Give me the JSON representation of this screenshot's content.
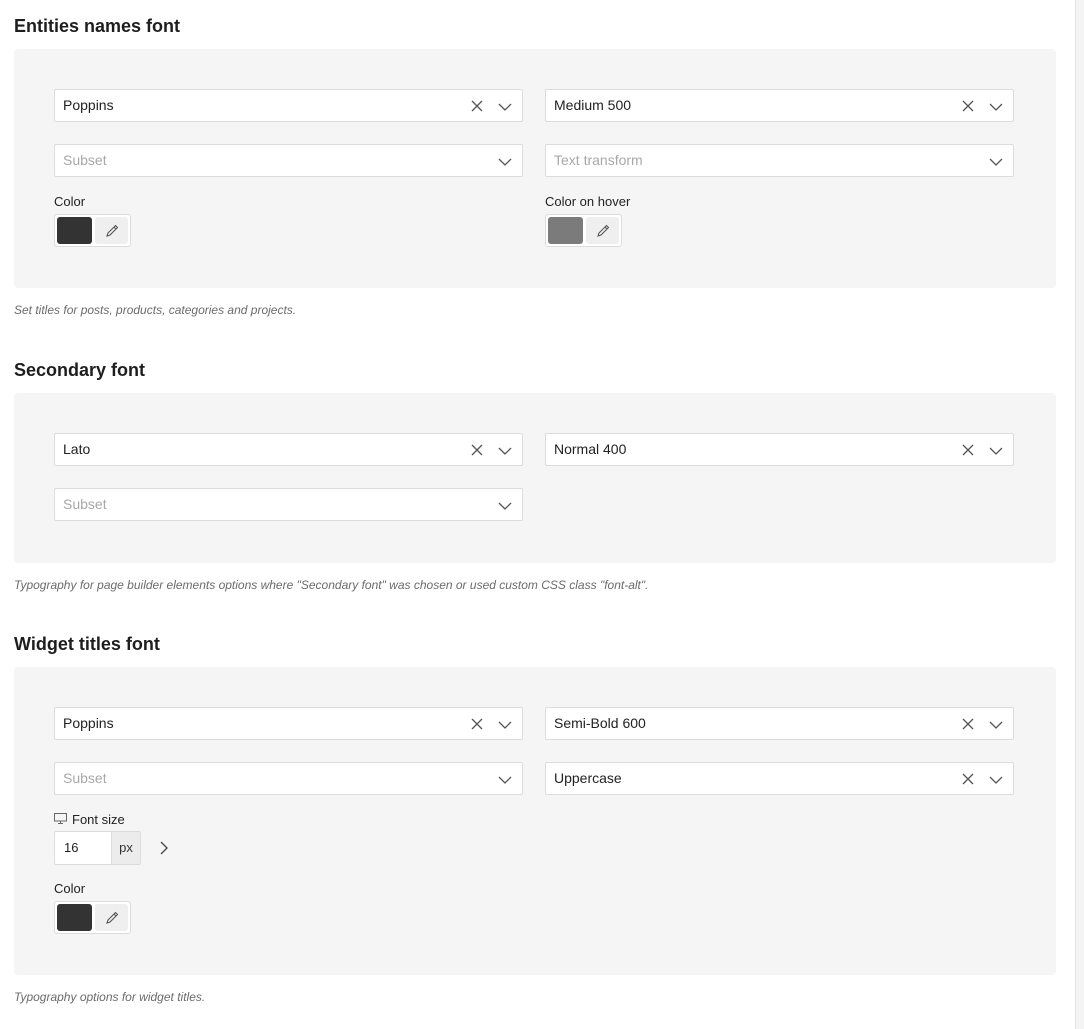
{
  "sections": {
    "entities": {
      "title": "Entities names font",
      "font_family": "Poppins",
      "font_weight": "Medium 500",
      "subset_placeholder": "Subset",
      "text_transform_placeholder": "Text transform",
      "color_label": "Color",
      "color_value": "#333333",
      "hover_label": "Color on hover",
      "hover_value": "#7b7b7b",
      "description": "Set titles for posts, products, categories and projects."
    },
    "secondary": {
      "title": "Secondary font",
      "font_family": "Lato",
      "font_weight": "Normal 400",
      "subset_placeholder": "Subset",
      "description": "Typography for page builder elements options where \"Secondary font\" was chosen or used custom CSS class \"font-alt\"."
    },
    "widget": {
      "title": "Widget titles font",
      "font_family": "Poppins",
      "font_weight": "Semi-Bold 600",
      "subset_placeholder": "Subset",
      "text_transform": "Uppercase",
      "font_size_label": "Font size",
      "font_size_value": "16",
      "font_size_unit": "px",
      "color_label": "Color",
      "color_value": "#333333",
      "description": "Typography options for widget titles."
    }
  },
  "icons": [
    "clear-icon",
    "chevron-down-icon",
    "eyedropper-icon",
    "desktop-icon",
    "chevron-right-icon"
  ],
  "colors": {
    "panel_bg": "#f5f5f5",
    "border": "#dcdcdc",
    "text_muted": "#6b6b6b"
  }
}
